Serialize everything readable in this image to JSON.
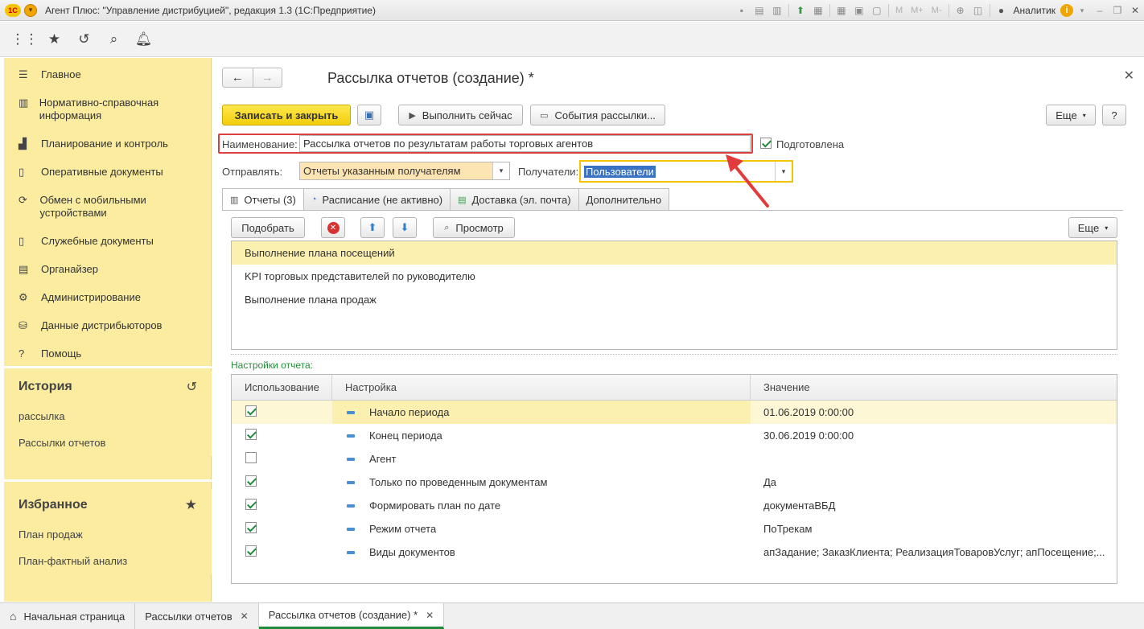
{
  "window": {
    "logo": "1C",
    "title": "Агент Плюс: \"Управление дистрибуцией\", редакция 1.3  (1С:Предприятие)",
    "user": "Аналитик",
    "m_buttons": [
      "M",
      "M+",
      "M-"
    ]
  },
  "sidebar": {
    "items": [
      {
        "icon": "menu-icon",
        "label": "Главное"
      },
      {
        "icon": "reference-icon",
        "label": "Нормативно-справочная информация"
      },
      {
        "icon": "chart-icon",
        "label": "Планирование и контроль"
      },
      {
        "icon": "documents-icon",
        "label": "Оперативные документы"
      },
      {
        "icon": "sync-icon",
        "label": "Обмен с мобильными устройствами"
      },
      {
        "icon": "service-docs-icon",
        "label": "Служебные документы"
      },
      {
        "icon": "organizer-icon",
        "label": "Органайзер"
      },
      {
        "icon": "gear-icon",
        "label": "Администрирование"
      },
      {
        "icon": "distributor-icon",
        "label": "Данные дистрибьюторов"
      },
      {
        "icon": "help-icon",
        "label": "Помощь"
      }
    ],
    "history": {
      "title": "История",
      "items": [
        "рассылка",
        "Рассылки отчетов"
      ]
    },
    "favorites": {
      "title": "Избранное",
      "items": [
        "План продаж",
        "План-фактный анализ"
      ]
    }
  },
  "form": {
    "title": "Рассылка отчетов (создание) *",
    "buttons": {
      "save_close": "Записать и закрыть",
      "run_now": "Выполнить сейчас",
      "events": "События рассылки...",
      "more": "Еще",
      "help": "?"
    },
    "name_label": "Наименование:",
    "name_value": "Рассылка отчетов по результатам работы торговых агентов",
    "prepared_label": "Подготовлена",
    "prepared_checked": true,
    "send_label": "Отправлять:",
    "send_value": "Отчеты указанным получателям",
    "recipients_label": "Получатели:",
    "recipients_value": "Пользователи",
    "tabs": [
      {
        "label": "Отчеты (3)",
        "active": true
      },
      {
        "label": "Расписание (не активно)",
        "active": false
      },
      {
        "label": "Доставка (эл. почта)",
        "active": false
      },
      {
        "label": "Дополнительно",
        "active": false
      }
    ],
    "reports_toolbar": {
      "pick": "Подобрать",
      "preview": "Просмотр",
      "more": "Еще"
    },
    "reports": [
      "Выполнение плана посещений",
      "KPI торговых представителей по руководителю",
      "Выполнение плана продаж"
    ],
    "settings_label": "Настройки отчета:",
    "grid_columns": [
      "Использование",
      "Настройка",
      "Значение"
    ],
    "grid_rows": [
      {
        "used": true,
        "setting": "Начало периода",
        "value": "01.06.2019 0:00:00"
      },
      {
        "used": true,
        "setting": "Конец периода",
        "value": "30.06.2019 0:00:00"
      },
      {
        "used": false,
        "setting": "Агент",
        "value": ""
      },
      {
        "used": true,
        "setting": "Только по проведенным документам",
        "value": "Да"
      },
      {
        "used": true,
        "setting": "Формировать план по дате",
        "value": "документаВБД"
      },
      {
        "used": true,
        "setting": "Режим отчета",
        "value": "ПоТрекам"
      },
      {
        "used": true,
        "setting": "Виды документов",
        "value": "апЗадание; ЗаказКлиента; РеализацияТоваровУслуг; апПосещение;..."
      }
    ]
  },
  "taskbar": {
    "home": "Начальная страница",
    "tabs": [
      "Рассылки отчетов",
      "Рассылка отчетов (создание) *"
    ]
  },
  "colors": {
    "accent_yellow": "#f5d31c",
    "sidebar_bg": "#fbeca0",
    "highlight_red": "#d94040",
    "check_green": "#1f8a3a"
  }
}
